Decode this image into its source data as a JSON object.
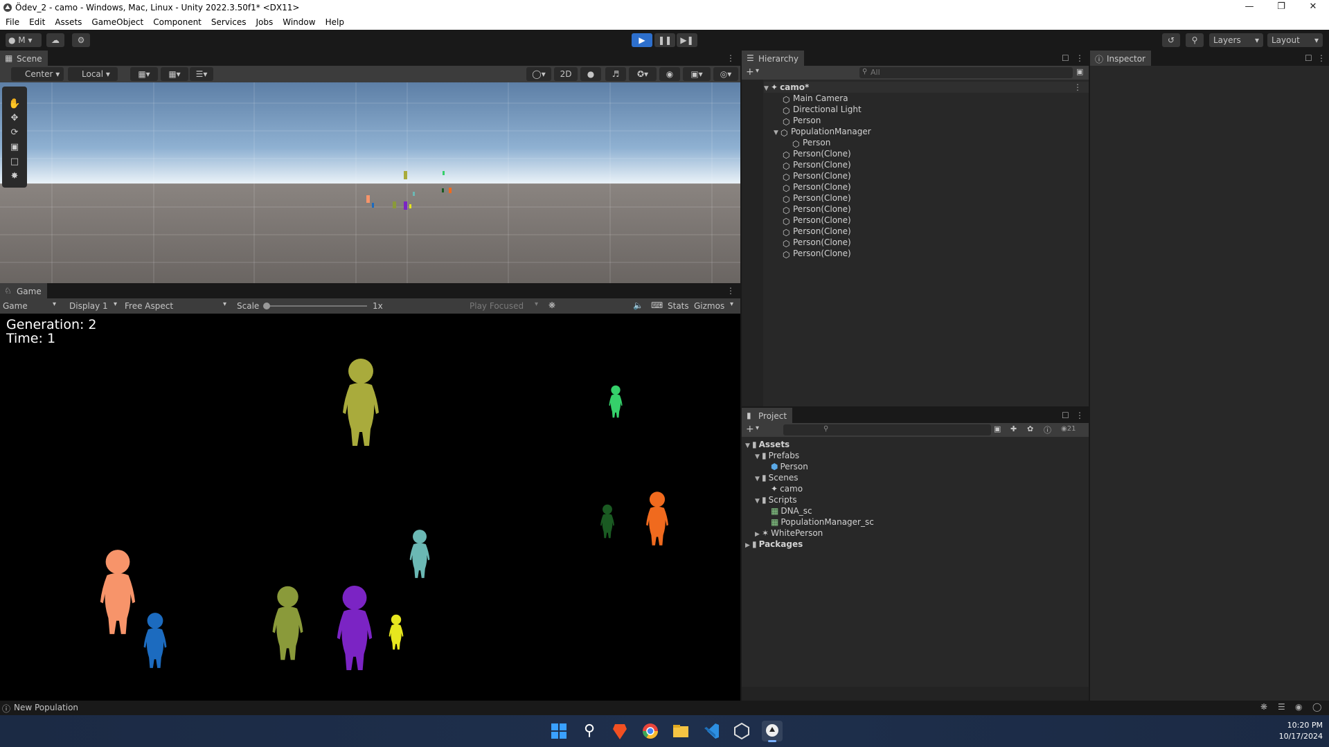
{
  "window": {
    "title": "Ödev_2 - camo - Windows, Mac, Linux - Unity 2022.3.50f1* <DX11>"
  },
  "menu": [
    "File",
    "Edit",
    "Assets",
    "GameObject",
    "Component",
    "Services",
    "Jobs",
    "Window",
    "Help"
  ],
  "toolbar": {
    "account": "M",
    "layers": "Layers",
    "layout": "Layout"
  },
  "scene": {
    "tab": "Scene",
    "pivot": "Center",
    "space": "Local",
    "mode2d": "2D"
  },
  "game": {
    "tab": "Game",
    "view": "Game",
    "display": "Display 1",
    "aspect": "Free Aspect",
    "scale_label": "Scale",
    "scale_value": "1x",
    "play_focused": "Play Focused",
    "stats": "Stats",
    "gizmos": "Gizmos",
    "hud_generation": "Generation: 2",
    "hud_time": "Time: 1"
  },
  "hierarchy": {
    "tab": "Hierarchy",
    "search_placeholder": "All",
    "root": "camo*",
    "items": [
      "Main Camera",
      "Directional Light",
      "Person",
      "PopulationManager",
      "Person",
      "Person(Clone)",
      "Person(Clone)",
      "Person(Clone)",
      "Person(Clone)",
      "Person(Clone)",
      "Person(Clone)",
      "Person(Clone)",
      "Person(Clone)",
      "Person(Clone)",
      "Person(Clone)"
    ]
  },
  "inspector": {
    "tab": "Inspector"
  },
  "project": {
    "tab": "Project",
    "hidden_count": "21",
    "items": [
      "Assets",
      "Prefabs",
      "Person",
      "Scenes",
      "camo",
      "Scripts",
      "DNA_sc",
      "PopulationManager_sc",
      "WhitePerson",
      "Packages"
    ]
  },
  "status": {
    "message": "New Population"
  },
  "clock": {
    "time": "10:20 PM",
    "date": "10/17/2024"
  },
  "people_colors": [
    "#a9ab3c",
    "#35d06a",
    "#f06a1e",
    "#1a5a22",
    "#6bb8b4",
    "#f7946a",
    "#1c6bbf",
    "#8a9a3a",
    "#7b24c4",
    "#e6e61e"
  ],
  "accent": "#2d6fcc"
}
